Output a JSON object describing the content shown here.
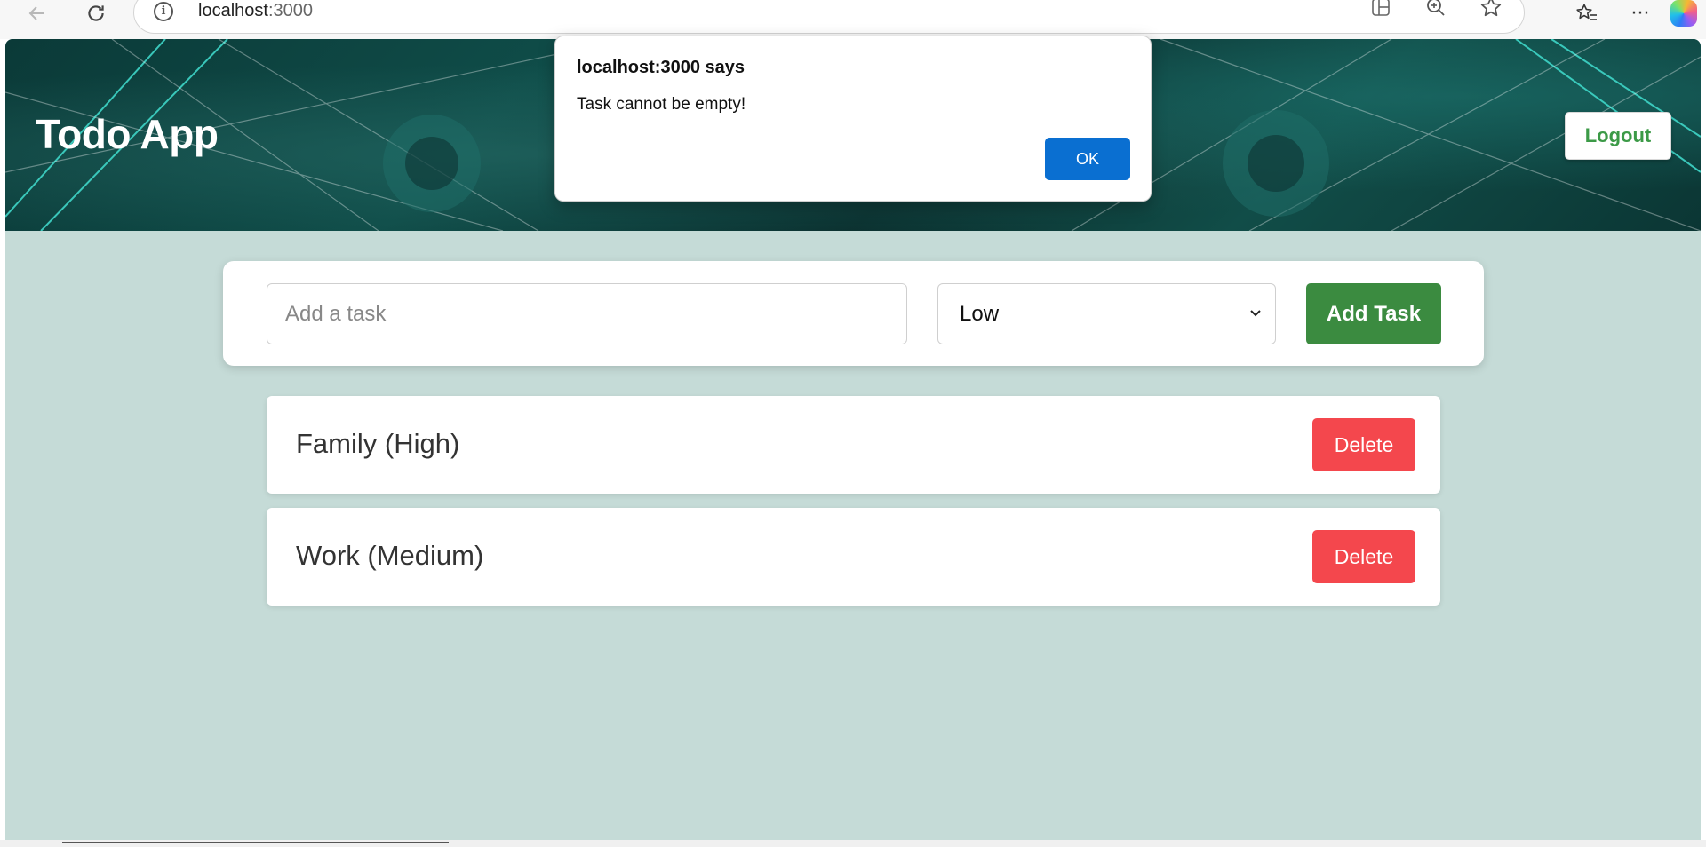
{
  "browser": {
    "url_host": "localhost",
    "url_port": ":3000"
  },
  "app": {
    "title": "Todo App",
    "logout_label": "Logout"
  },
  "add_form": {
    "task_placeholder": "Add a task",
    "task_value": "",
    "priority_selected": "Low",
    "add_label": "Add Task"
  },
  "tasks": [
    {
      "text": "Family (High)",
      "delete_label": "Delete"
    },
    {
      "text": "Work (Medium)",
      "delete_label": "Delete"
    }
  ],
  "dialog": {
    "title": "localhost:3000 says",
    "message": "Task cannot be empty!",
    "ok_label": "OK"
  },
  "colors": {
    "page_bg": "#c5dbd7",
    "add_button": "#3b8b40",
    "delete_button": "#f4474d",
    "logout_text": "#3c9a47",
    "dialog_ok": "#0a6fd1"
  }
}
